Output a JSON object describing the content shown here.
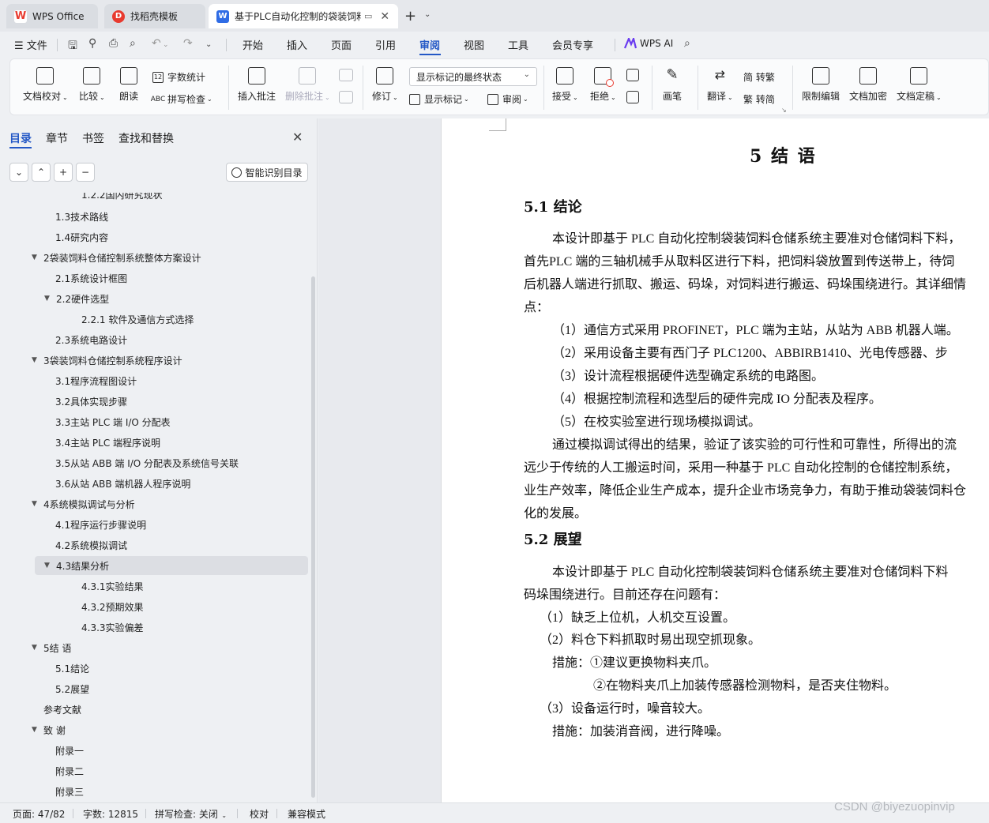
{
  "tabs": {
    "wps_office": "WPS Office",
    "template": "找稻壳模板",
    "document": "基于PLC自动化控制的袋装饲料"
  },
  "menu": {
    "file": "文件",
    "items": [
      "开始",
      "插入",
      "页面",
      "引用",
      "审阅",
      "视图",
      "工具",
      "会员专享"
    ],
    "active": "审阅",
    "wps_ai": "WPS AI"
  },
  "ribbon": {
    "doc_proof": "文档校对",
    "compare": "比较",
    "read_aloud": "朗读",
    "word_count": "字数统计",
    "spell_check": "拼写检查",
    "insert_comment": "插入批注",
    "delete_comment": "删除批注",
    "revise": "修订",
    "markup_state": "显示标记的最终状态",
    "show_markup": "显示标记",
    "review": "审阅",
    "accept": "接受",
    "reject": "拒绝",
    "pen": "画笔",
    "translate": "翻译",
    "to_traditional": "简 转繁",
    "to_simplified": "繁 转简",
    "restrict_edit": "限制编辑",
    "encrypt": "文档加密",
    "finalize": "文档定稿"
  },
  "nav": {
    "tabs": [
      "目录",
      "章节",
      "书签",
      "查找和替换"
    ],
    "smart_toc": "智能识别目录",
    "toc": [
      {
        "label": "1.2.2国内研究现状"
      },
      {
        "label": "1.3技术路线"
      },
      {
        "label": "1.4研究内容"
      },
      {
        "label": "2袋装饲料仓储控制系统整体方案设计"
      },
      {
        "label": "2.1系统设计框图"
      },
      {
        "label": "2.2硬件选型"
      },
      {
        "label": "2.2.1 软件及通信方式选择"
      },
      {
        "label": "2.3系统电路设计"
      },
      {
        "label": "3袋装饲料仓储控制系统程序设计"
      },
      {
        "label": "3.1程序流程图设计"
      },
      {
        "label": "3.2具体实现步骤"
      },
      {
        "label": "3.3主站 PLC 端 I/O 分配表"
      },
      {
        "label": "3.4主站 PLC 端程序说明"
      },
      {
        "label": "3.5从站 ABB 端 I/O 分配表及系统信号关联"
      },
      {
        "label": "3.6从站 ABB 端机器人程序说明"
      },
      {
        "label": "4系统模拟调试与分析"
      },
      {
        "label": "4.1程序运行步骤说明"
      },
      {
        "label": "4.2系统模拟调试"
      },
      {
        "label": "4.3结果分析"
      },
      {
        "label": "4.3.1实验结果"
      },
      {
        "label": "4.3.2预期效果"
      },
      {
        "label": "4.3.3实验偏差"
      },
      {
        "label": "5结 语"
      },
      {
        "label": "5.1结论"
      },
      {
        "label": "5.2展望"
      },
      {
        "label": "参考文献"
      },
      {
        "label": "致 谢"
      },
      {
        "label": "附录一"
      },
      {
        "label": "附录二"
      },
      {
        "label": "附录三"
      }
    ]
  },
  "document": {
    "chapter_title": "5  结  语",
    "s51_title": "5.1  结论",
    "s51_lines": [
      "本设计即基于 PLC 自动化控制袋装饲料仓储系统主要准对仓储饲料下料，",
      "首先PLC 端的三轴机械手从取料区进行下料，把饲料袋放置到传送带上，待饲",
      "后机器人端进行抓取、搬运、码垛，对饲料进行搬运、码垛围绕进行。其详细情",
      "点："
    ],
    "s51_points": [
      "（1）通信方式采用 PROFINET，PLC 端为主站，从站为 ABB 机器人端。",
      "（2）采用设备主要有西门子 PLC1200、ABBIRB1410、光电传感器、步",
      "（3）设计流程根据硬件选型确定系统的电路图。",
      "（4）根据控制流程和选型后的硬件完成 IO 分配表及程序。",
      "（5）在校实验室进行现场模拟调试。"
    ],
    "s51_lines2": [
      "通过模拟调试得出的结果，验证了该实验的可行性和可靠性，所得出的流",
      "远少于传统的人工搬运时间，采用一种基于 PLC 自动化控制的仓储控制系统，",
      "业生产效率，降低企业生产成本，提升企业市场竞争力，有助于推动袋装饲料仓",
      "化的发展。"
    ],
    "s52_title": "5.2  展望",
    "s52_lines": [
      "本设计即基于 PLC 自动化控制袋装饲料仓储系统主要准对仓储饲料下料",
      "码垛围绕进行。目前还存在问题有：",
      "（1）缺乏上位机，人机交互设置。",
      "（2）料仓下料抓取时易出现空抓现象。",
      "措施：①建议更换物料夹爪。",
      "②在物料夹爪上加装传感器检测物料，是否夹住物料。",
      "（3）设备运行时，噪音较大。",
      "措施：加装消音阀，进行降噪。"
    ]
  },
  "status": {
    "page": "页面: 47/82",
    "words": "字数: 12815",
    "spell": "拼写检查: 关闭",
    "proof": "校对",
    "compat": "兼容模式"
  },
  "watermark": "CSDN @biyezuopinvip",
  "colors": {
    "accent": "#2458c6",
    "wps_red": "#e83a2f",
    "doc_blue": "#2f6ce5"
  }
}
